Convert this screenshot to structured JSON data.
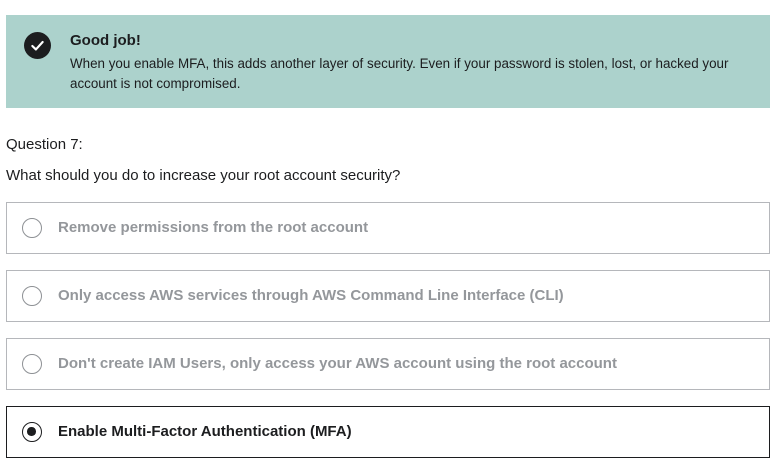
{
  "feedback": {
    "icon": "check-circle-icon",
    "title": "Good job!",
    "message": "When you enable MFA, this adds another layer of security. Even if your password is stolen, lost, or hacked your account is not compromised.",
    "background_color": "#acd2cc"
  },
  "question": {
    "number_label": "Question 7:",
    "text": "What should you do to increase your root account security?"
  },
  "options": [
    {
      "label": "Remove permissions from the root account",
      "selected": false
    },
    {
      "label": "Only access AWS services through AWS Command Line Interface (CLI)",
      "selected": false
    },
    {
      "label": "Don't create IAM Users, only access your AWS account using the root account",
      "selected": false
    },
    {
      "label": "Enable Multi-Factor Authentication (MFA)",
      "selected": true
    }
  ]
}
